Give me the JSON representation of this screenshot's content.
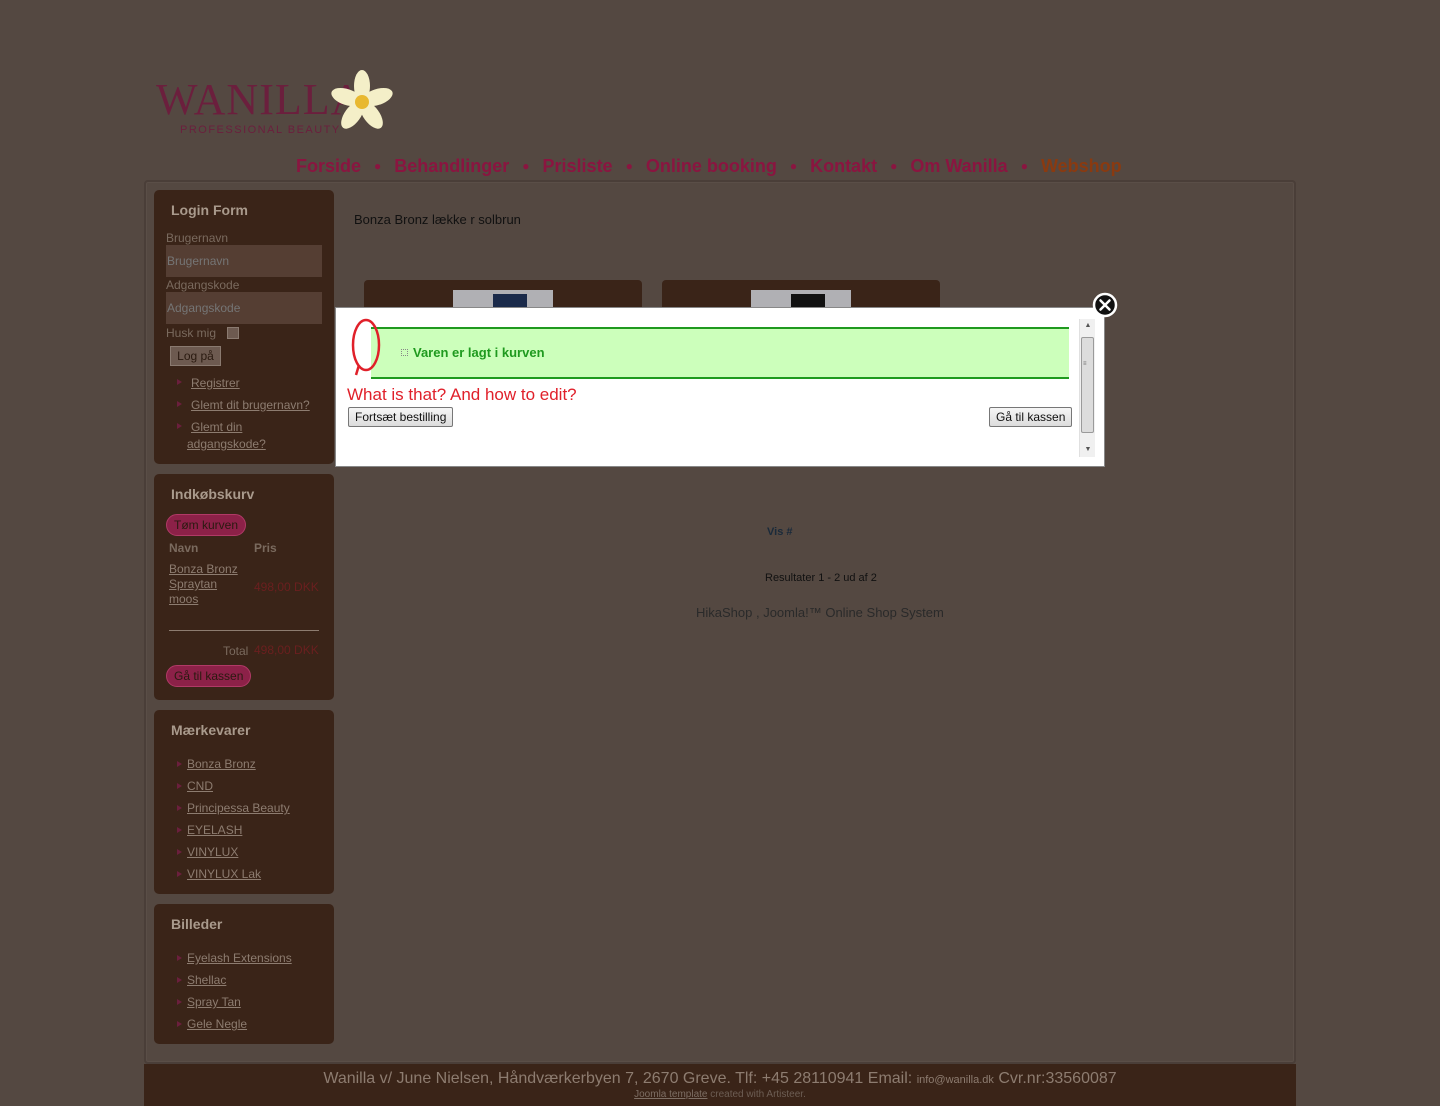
{
  "header": {
    "logo_text": "WANILLA",
    "logo_sub": "PROFESSIONAL BEAUTY",
    "nav": [
      "Forside",
      "Behandlinger",
      "Prisliste",
      "Online booking",
      "Kontakt",
      "Om Wanilla",
      "Webshop"
    ],
    "active_nav": "Webshop"
  },
  "login": {
    "title": "Login Form",
    "user_label": "Brugernavn",
    "user_placeholder": "Brugernavn",
    "pass_label": "Adgangskode",
    "pass_placeholder": "Adgangskode",
    "remember": "Husk mig",
    "button": "Log på",
    "links": [
      "Registrer",
      "Glemt dit brugernavn?",
      "Glemt din",
      "adgangskode?"
    ]
  },
  "cart": {
    "title": "Indkøbskurv",
    "empty_button": "Tøm kurven",
    "col_name": "Navn",
    "col_price": "Pris",
    "item_lines": [
      "Bonza Bronz",
      "Spraytan",
      "moos"
    ],
    "item_price": "498,00 DKK",
    "total_label": "Total",
    "total_value": "498,00 DKK",
    "checkout_button": "Gå til kassen"
  },
  "brands": {
    "title": "Mærkevarer",
    "items": [
      "Bonza Bronz",
      "CND",
      "Principessa Beauty",
      "EYELASH",
      "VINYLUX",
      "VINYLUX Lak"
    ]
  },
  "pictures": {
    "title": "Billeder",
    "items": [
      "Eyelash Extensions",
      "Shellac",
      "Spray Tan",
      "Gele Negle"
    ]
  },
  "content": {
    "title": "Bonza Bronz lække r solbrun",
    "vis": "Vis #",
    "results": "Resultater 1 - 2 ud af 2",
    "powered": "HikaShop , Joomla!™ Online Shop System"
  },
  "modal": {
    "message": "Varen er lagt i kurven",
    "annotation": "What is that? And how to edit?",
    "continue_button": "Fortsæt bestilling",
    "checkout_button": "Gå til kassen"
  },
  "footer": {
    "address": "Wanilla v/ June Nielsen, Håndværkerbyen 7, 2670 Greve. Tlf: +45 28110941 Email:",
    "email": "info@wanilla.dk",
    "cvr": "Cvr.nr:33560087",
    "template_link": "Joomla template",
    "template_suffix": "created with Artisteer."
  },
  "colors": {
    "background": "#544841",
    "box": "#3a2418",
    "accent": "#8a1540",
    "notice_green": "#1f9a1f",
    "annotation_red": "#e0202a"
  }
}
